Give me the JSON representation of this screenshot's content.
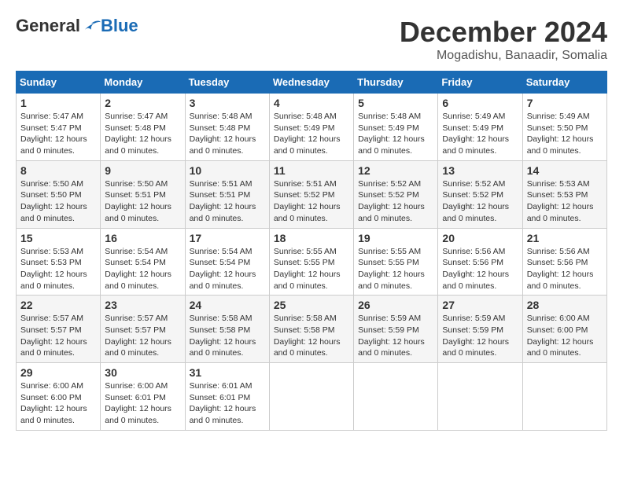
{
  "logo": {
    "general": "General",
    "blue": "Blue"
  },
  "title": "December 2024",
  "location": "Mogadishu, Banaadir, Somalia",
  "headers": [
    "Sunday",
    "Monday",
    "Tuesday",
    "Wednesday",
    "Thursday",
    "Friday",
    "Saturday"
  ],
  "weeks": [
    [
      {
        "day": "1",
        "sunrise": "5:47 AM",
        "sunset": "5:47 PM",
        "daylight": "12 hours and 0 minutes."
      },
      {
        "day": "2",
        "sunrise": "5:47 AM",
        "sunset": "5:48 PM",
        "daylight": "12 hours and 0 minutes."
      },
      {
        "day": "3",
        "sunrise": "5:48 AM",
        "sunset": "5:48 PM",
        "daylight": "12 hours and 0 minutes."
      },
      {
        "day": "4",
        "sunrise": "5:48 AM",
        "sunset": "5:49 PM",
        "daylight": "12 hours and 0 minutes."
      },
      {
        "day": "5",
        "sunrise": "5:48 AM",
        "sunset": "5:49 PM",
        "daylight": "12 hours and 0 minutes."
      },
      {
        "day": "6",
        "sunrise": "5:49 AM",
        "sunset": "5:49 PM",
        "daylight": "12 hours and 0 minutes."
      },
      {
        "day": "7",
        "sunrise": "5:49 AM",
        "sunset": "5:50 PM",
        "daylight": "12 hours and 0 minutes."
      }
    ],
    [
      {
        "day": "8",
        "sunrise": "5:50 AM",
        "sunset": "5:50 PM",
        "daylight": "12 hours and 0 minutes."
      },
      {
        "day": "9",
        "sunrise": "5:50 AM",
        "sunset": "5:51 PM",
        "daylight": "12 hours and 0 minutes."
      },
      {
        "day": "10",
        "sunrise": "5:51 AM",
        "sunset": "5:51 PM",
        "daylight": "12 hours and 0 minutes."
      },
      {
        "day": "11",
        "sunrise": "5:51 AM",
        "sunset": "5:52 PM",
        "daylight": "12 hours and 0 minutes."
      },
      {
        "day": "12",
        "sunrise": "5:52 AM",
        "sunset": "5:52 PM",
        "daylight": "12 hours and 0 minutes."
      },
      {
        "day": "13",
        "sunrise": "5:52 AM",
        "sunset": "5:52 PM",
        "daylight": "12 hours and 0 minutes."
      },
      {
        "day": "14",
        "sunrise": "5:53 AM",
        "sunset": "5:53 PM",
        "daylight": "12 hours and 0 minutes."
      }
    ],
    [
      {
        "day": "15",
        "sunrise": "5:53 AM",
        "sunset": "5:53 PM",
        "daylight": "12 hours and 0 minutes."
      },
      {
        "day": "16",
        "sunrise": "5:54 AM",
        "sunset": "5:54 PM",
        "daylight": "12 hours and 0 minutes."
      },
      {
        "day": "17",
        "sunrise": "5:54 AM",
        "sunset": "5:54 PM",
        "daylight": "12 hours and 0 minutes."
      },
      {
        "day": "18",
        "sunrise": "5:55 AM",
        "sunset": "5:55 PM",
        "daylight": "12 hours and 0 minutes."
      },
      {
        "day": "19",
        "sunrise": "5:55 AM",
        "sunset": "5:55 PM",
        "daylight": "12 hours and 0 minutes."
      },
      {
        "day": "20",
        "sunrise": "5:56 AM",
        "sunset": "5:56 PM",
        "daylight": "12 hours and 0 minutes."
      },
      {
        "day": "21",
        "sunrise": "5:56 AM",
        "sunset": "5:56 PM",
        "daylight": "12 hours and 0 minutes."
      }
    ],
    [
      {
        "day": "22",
        "sunrise": "5:57 AM",
        "sunset": "5:57 PM",
        "daylight": "12 hours and 0 minutes."
      },
      {
        "day": "23",
        "sunrise": "5:57 AM",
        "sunset": "5:57 PM",
        "daylight": "12 hours and 0 minutes."
      },
      {
        "day": "24",
        "sunrise": "5:58 AM",
        "sunset": "5:58 PM",
        "daylight": "12 hours and 0 minutes."
      },
      {
        "day": "25",
        "sunrise": "5:58 AM",
        "sunset": "5:58 PM",
        "daylight": "12 hours and 0 minutes."
      },
      {
        "day": "26",
        "sunrise": "5:59 AM",
        "sunset": "5:59 PM",
        "daylight": "12 hours and 0 minutes."
      },
      {
        "day": "27",
        "sunrise": "5:59 AM",
        "sunset": "5:59 PM",
        "daylight": "12 hours and 0 minutes."
      },
      {
        "day": "28",
        "sunrise": "6:00 AM",
        "sunset": "6:00 PM",
        "daylight": "12 hours and 0 minutes."
      }
    ],
    [
      {
        "day": "29",
        "sunrise": "6:00 AM",
        "sunset": "6:00 PM",
        "daylight": "12 hours and 0 minutes."
      },
      {
        "day": "30",
        "sunrise": "6:00 AM",
        "sunset": "6:01 PM",
        "daylight": "12 hours and 0 minutes."
      },
      {
        "day": "31",
        "sunrise": "6:01 AM",
        "sunset": "6:01 PM",
        "daylight": "12 hours and 0 minutes."
      },
      null,
      null,
      null,
      null
    ]
  ],
  "labels": {
    "sunrise": "Sunrise:",
    "sunset": "Sunset:",
    "daylight": "Daylight:"
  }
}
